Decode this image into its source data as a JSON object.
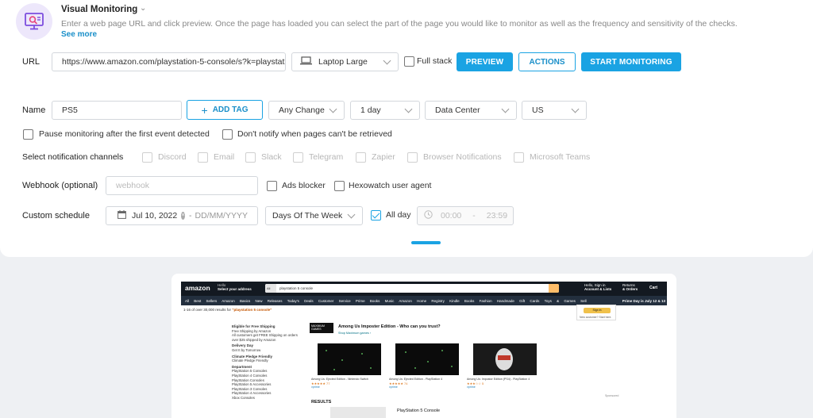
{
  "tool": {
    "title": "Visual Monitoring",
    "description": "Enter a web page URL and click preview. Once the page has loaded you can select the part of the page you would like to monitor as well as the frequency and sensitivity of the checks.",
    "see_more": "See more"
  },
  "url_row": {
    "label": "URL",
    "value": "https://www.amazon.com/playstation-5-console/s?k=playstation",
    "device": "Laptop Large",
    "full_stack_label": "Full stack",
    "full_stack_checked": false,
    "preview_label": "PREVIEW",
    "actions_label": "ACTIONS",
    "start_label": "START MONITORING"
  },
  "name_row": {
    "label": "Name",
    "value": "PS5",
    "add_tag_label": "ADD TAG",
    "change_type": "Any Change",
    "frequency": "1 day",
    "location_type": "Data Center",
    "region": "US"
  },
  "options": {
    "pause_label": "Pause monitoring after the first event detected",
    "dont_notify_label": "Don't notify when pages can't be retrieved"
  },
  "notifications": {
    "label": "Select notification channels",
    "channels": [
      "Discord",
      "Email",
      "Slack",
      "Telegram",
      "Zapier",
      "Browser Notifications",
      "Microsoft Teams"
    ]
  },
  "webhook": {
    "label": "Webhook (optional)",
    "placeholder": "webhook",
    "ads_blocker_label": "Ads blocker",
    "user_agent_label": "Hexowatch user agent"
  },
  "schedule": {
    "label": "Custom schedule",
    "start_date": "Jul 10, 2022",
    "end_placeholder": "DD/MM/YYYY",
    "period": "Days Of The Week",
    "all_day_label": "All day",
    "all_day_checked": true,
    "time_from": "00:00",
    "time_to": "23:59"
  },
  "preview_page": {
    "logo": "amazon",
    "deliver_line1": "Hello",
    "deliver_line2": "Select your address",
    "search_dept": "All",
    "search_query": "playstation 5 console",
    "account_line1": "Hello, Sign in",
    "account_line2": "Account & Lists",
    "returns_line1": "Returns",
    "returns_line2": "& Orders",
    "cart": "Cart",
    "nav_items": "All Best Sellers Amazon Basics New Releases Today's Deals Customer Service Prime Books Music Amazon Home Registry Kindle Books Fashion Handmade Gift Cards Toys & Games Sell",
    "promo": "Prime Day is July 12 & 13",
    "sign_in": "Sign in",
    "new_customer": "New customer? Start here.",
    "results_count": "1-16 of over 30,000 results for",
    "results_query": "\"playstation 5 console\"",
    "sidebar": [
      {
        "heading": "Eligible for Free Shipping",
        "items": [
          "Free Shipping by Amazon",
          "All customers get FREE Shipping on orders over $25 shipped by Amazon"
        ]
      },
      {
        "heading": "Delivery Day",
        "items": [
          "Get It by Tomorrow"
        ]
      },
      {
        "heading": "Climate Pledge Friendly",
        "items": [
          "Climate Pledge Friendly"
        ]
      },
      {
        "heading": "Department",
        "items": [
          "PlayStation 5 Consoles",
          "PlayStation 4 Consoles",
          "PlayStation Consoles",
          "PlayStation 5 Accessories",
          "PlayStation 3 Consoles",
          "PlayStation 4 Accessories",
          "Xbox Consoles"
        ]
      }
    ],
    "brand": "MAXIMUM GAMES",
    "ad_title": "Among Us Imposter Edition - Who can you trust?",
    "ad_sub": "Shop Maximum games ›",
    "products": [
      {
        "title": "Among Us: Ejected Edition - Nintendo Switch",
        "rating": "★★★★★ 77",
        "price": "vprime"
      },
      {
        "title": "Among Us: Ejected Edition - PlayStation 4",
        "rating": "★★★★★ 74",
        "price": "vprime"
      },
      {
        "title": "Among Us: Impostor Edition (PS4) - PlayStation 4",
        "rating": "★★★☆☆ 5",
        "price": "vprime"
      }
    ],
    "sponsored": "Sponsored",
    "results_heading": "RESULTS",
    "result_title": "PlayStation 5 Console"
  }
}
